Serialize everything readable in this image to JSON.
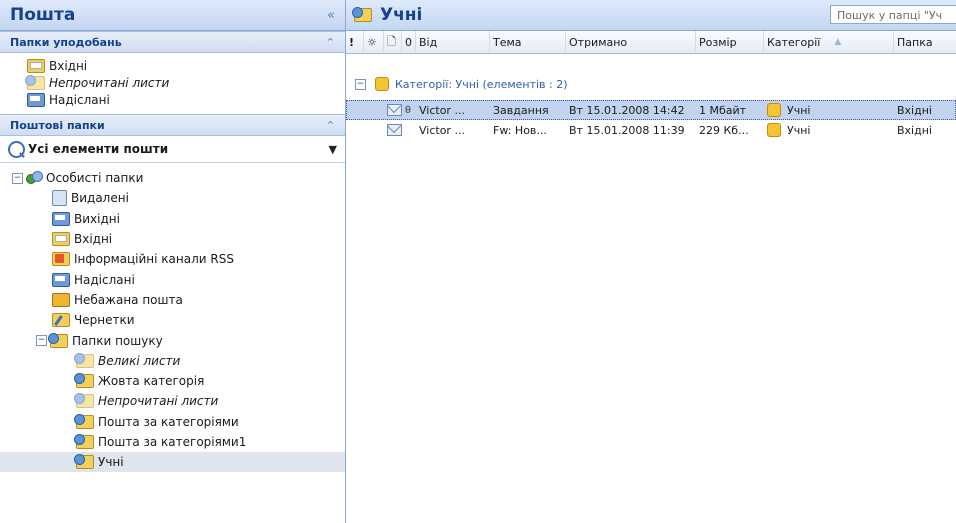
{
  "nav": {
    "title": "Пошта",
    "collapse_glyph": "«",
    "favorites_header": "Папки уподобань",
    "favorites": [
      {
        "label": "Вхідні",
        "icon": "inbox-folder-icon",
        "italic": false
      },
      {
        "label": "Непрочитані листи",
        "icon": "search-folder-icon",
        "italic": true
      },
      {
        "label": "Надіслані",
        "icon": "sent-folder-icon",
        "italic": false
      }
    ],
    "mail_folders_header": "Поштові папки",
    "all_items_label": "Усі елементи пошти",
    "tree": {
      "root_label": "Особисті папки",
      "folders": [
        {
          "label": "Видалені",
          "icon": "trash-icon"
        },
        {
          "label": "Вихідні",
          "icon": "outbox-folder-icon"
        },
        {
          "label": "Вхідні",
          "icon": "inbox-folder-icon"
        },
        {
          "label": "Інформаційні канали RSS",
          "icon": "rss-folder-icon"
        },
        {
          "label": "Надіслані",
          "icon": "sent-folder-icon"
        },
        {
          "label": "Небажана пошта",
          "icon": "junk-folder-icon"
        },
        {
          "label": "Чернетки",
          "icon": "drafts-folder-icon"
        }
      ],
      "search_root_label": "Папки пошуку",
      "search_folders": [
        {
          "label": "Великі листи",
          "italic": true
        },
        {
          "label": "Жовта категорія",
          "italic": false
        },
        {
          "label": "Непрочитані листи",
          "italic": true
        },
        {
          "label": "Пошта за категоріями",
          "italic": false
        },
        {
          "label": "Пошта за категоріями1",
          "italic": false
        },
        {
          "label": "Учні",
          "italic": false
        }
      ]
    }
  },
  "main": {
    "title": "Учні",
    "search_placeholder": "Пошук у папці \"Уч",
    "columns": {
      "importance": "!",
      "reminder": "☼",
      "type": "🗋",
      "attachment": "0",
      "from": "Від",
      "subject": "Тема",
      "received": "Отримано",
      "size": "Розмір",
      "categories": "Категорії",
      "folder": "Папка"
    },
    "group_label": "Категорії: Учні (елементів : 2)",
    "messages": [
      {
        "from": "Victor ...",
        "subject": "Завдання",
        "received": "Вт 15.01.2008 14:42",
        "size": "1 Мбайт",
        "category": "Учні",
        "folder": "Вхідні",
        "attachment": true,
        "selected": true
      },
      {
        "from": "Victor ...",
        "subject": "Fw: Нов...",
        "received": "Вт 15.01.2008 11:39",
        "size": "229 Кб...",
        "category": "Учні",
        "folder": "Вхідні",
        "attachment": false,
        "selected": false
      }
    ],
    "category_color": "#f4c432"
  }
}
